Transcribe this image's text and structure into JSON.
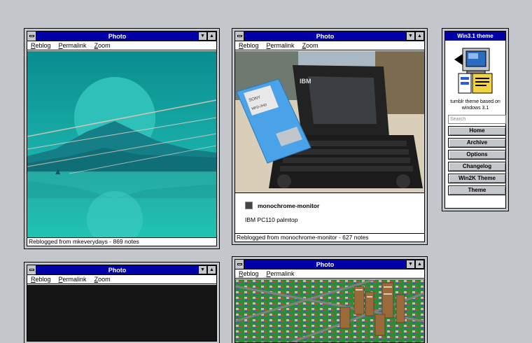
{
  "posts": [
    {
      "title": "Photo",
      "menu": [
        "Reblog",
        "Permalink",
        "Zoom"
      ],
      "status": "Reblogged from mkeverydays - 869 notes"
    },
    {
      "title": "Photo",
      "menu": [
        "Reblog",
        "Permalink",
        "Zoom"
      ],
      "author": "monochrome-monitor",
      "caption": "IBM PC110 palmtop",
      "status": "Reblogged from monochrome-monitor - 627 notes",
      "photo_label_disk": "MFD-2HD",
      "photo_label_brand": "IBM",
      "photo_label_sony": "SONY"
    },
    {
      "title": "Photo",
      "menu": [
        "Reblog",
        "Permalink",
        "Zoom"
      ]
    },
    {
      "title": "Photo",
      "menu": [
        "Reblog",
        "Permalink"
      ]
    }
  ],
  "sidebar": {
    "title": "Win3.1 theme",
    "description": "tumblr theme based on windows 3.1",
    "search_placeholder": "Search",
    "buttons": [
      "Home",
      "Archive",
      "Options",
      "Changelog",
      "Win2K Theme",
      "Theme"
    ]
  },
  "icons": {
    "system_menu": "system-menu-icon",
    "minimize": "triangle-down-icon",
    "maximize": "triangle-up-icon",
    "computer": "computer-icon"
  },
  "colors": {
    "desktop": "#c3c7cb",
    "titlebar": "#0000a8",
    "window": "#ffffff"
  }
}
